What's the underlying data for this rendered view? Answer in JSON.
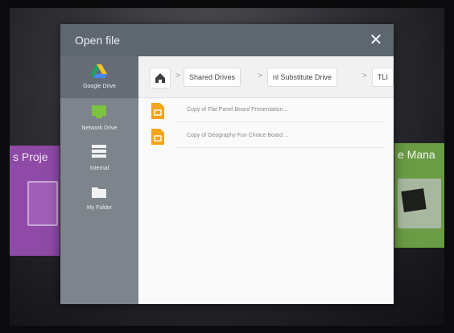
{
  "background": {
    "left_tile_title": "s Proje",
    "right_tile_title": "e Mana",
    "left_tile_color": "#8e4aa6",
    "right_tile_color": "#6a9b45"
  },
  "dialog": {
    "title": "Open file",
    "close_icon": "close-icon"
  },
  "sidebar": {
    "items": [
      {
        "label": "Google Drive",
        "icon": "google-drive-icon",
        "active": true
      },
      {
        "label": "Network Drive",
        "icon": "network-drive-icon",
        "active": false
      },
      {
        "label": "Internal",
        "icon": "internal-storage-icon",
        "active": false
      },
      {
        "label": "My Folder",
        "icon": "folder-icon",
        "active": false
      }
    ]
  },
  "breadcrumb": {
    "home_icon": "home-icon",
    "items": [
      "Shared Drives",
      "nl Substitute Drive",
      "TLI"
    ]
  },
  "files": [
    {
      "name": "Copy of Flat Panel Board Presentation...",
      "icon": "slides-file-icon"
    },
    {
      "name": "Copy of Geography Fun Choice Board ...",
      "icon": "slides-file-icon"
    }
  ],
  "colors": {
    "titlebar": "#5e6670",
    "sidebar": "#7d848c",
    "file_icon": "#f3a51d"
  }
}
